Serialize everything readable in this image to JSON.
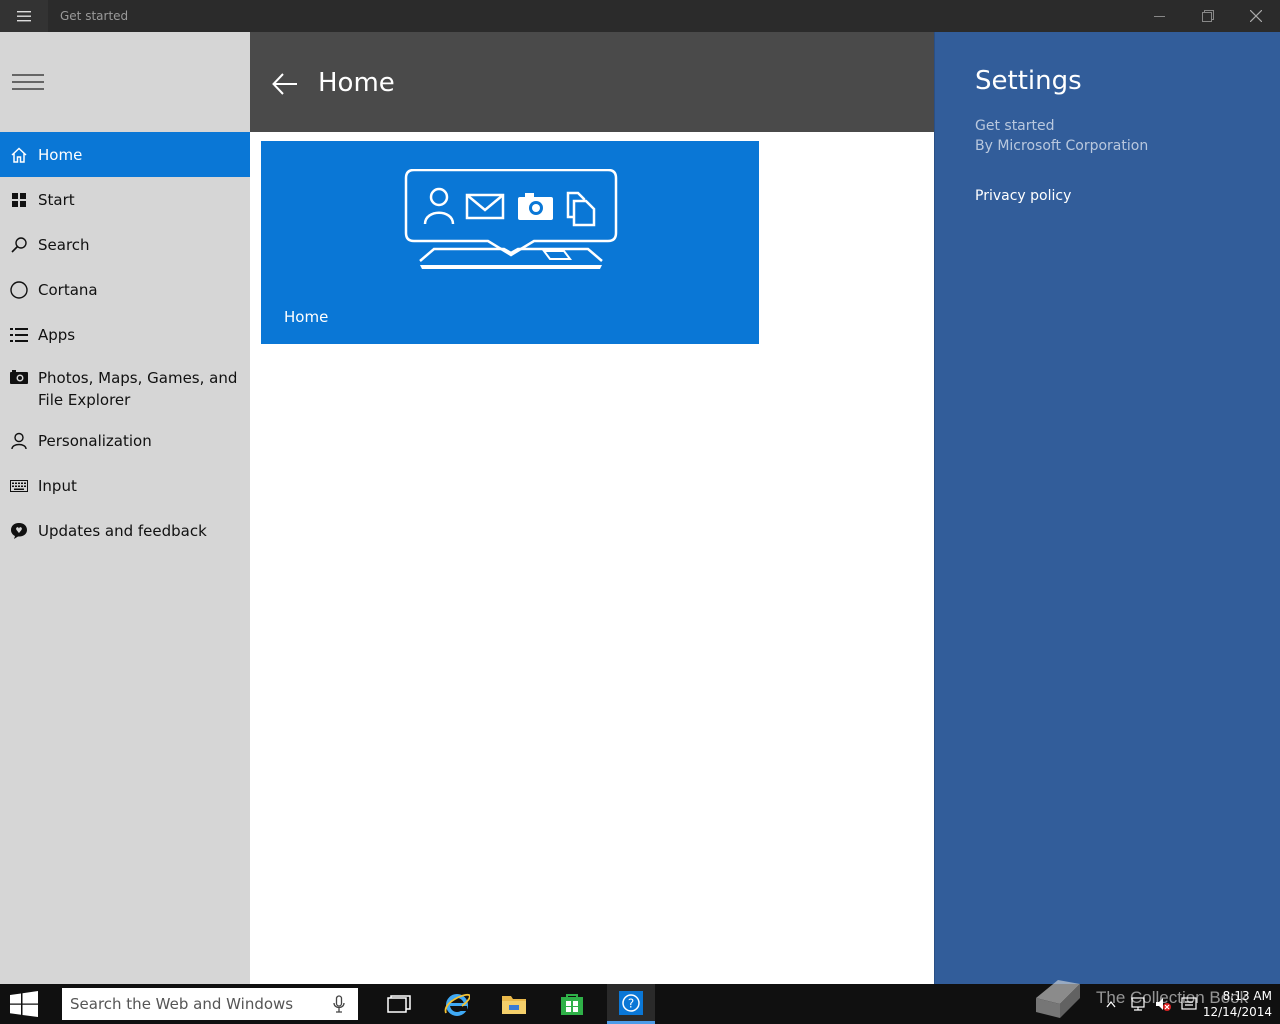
{
  "window": {
    "title": "Get started"
  },
  "sidebar": {
    "items": [
      {
        "label": "Home",
        "icon": "home-icon"
      },
      {
        "label": "Start",
        "icon": "start-grid-icon"
      },
      {
        "label": "Search",
        "icon": "search-icon"
      },
      {
        "label": "Cortana",
        "icon": "cortana-icon"
      },
      {
        "label": "Apps",
        "icon": "apps-list-icon"
      },
      {
        "label": "Photos, Maps, Games, and File Explorer",
        "icon": "camera-icon"
      },
      {
        "label": "Personalization",
        "icon": "person-icon"
      },
      {
        "label": "Input",
        "icon": "keyboard-icon"
      },
      {
        "label": "Updates and feedback",
        "icon": "feedback-icon"
      }
    ]
  },
  "main": {
    "title": "Home",
    "tile": {
      "label": "Home"
    }
  },
  "settings": {
    "title": "Settings",
    "app_name": "Get started",
    "publisher": "By Microsoft Corporation",
    "privacy_link": "Privacy policy"
  },
  "taskbar": {
    "search_placeholder": "Search the Web and Windows",
    "apps": [
      "task-view",
      "internet-explorer",
      "file-explorer",
      "store",
      "get-started"
    ],
    "time": "8:13 AM",
    "date": "12/14/2014",
    "watermark": "The Collection Book"
  },
  "colors": {
    "accent": "#0a77d6",
    "settings_bg": "#325d9a",
    "header_bg": "#4a4a4a",
    "sidebar_bg": "#d6d6d6"
  }
}
